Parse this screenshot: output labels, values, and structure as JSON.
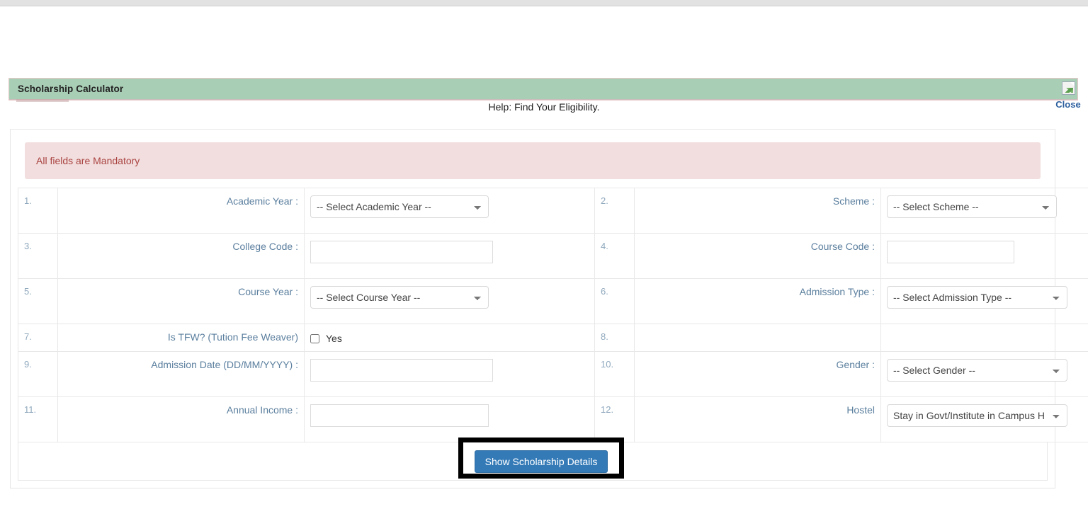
{
  "panel": {
    "title": "Scholarship Calculator",
    "close_icon": "broken-image-icon",
    "close_label": "Close"
  },
  "help_text": "Help: Find Your Eligibility.",
  "alert": {
    "message": "All fields are Mandatory"
  },
  "form": {
    "rows": [
      {
        "left": {
          "index": "1.",
          "label": "Academic Year :",
          "control": "select",
          "value": "-- Select Academic Year --"
        },
        "right": {
          "index": "2.",
          "label": "Scheme :",
          "control": "select",
          "value": "-- Select Scheme --"
        }
      },
      {
        "left": {
          "index": "3.",
          "label": "College Code :",
          "control": "text",
          "value": ""
        },
        "right": {
          "index": "4.",
          "label": "Course Code :",
          "control": "text",
          "value": ""
        }
      },
      {
        "left": {
          "index": "5.",
          "label": "Course Year :",
          "control": "select",
          "value": "-- Select Course Year --"
        },
        "right": {
          "index": "6.",
          "label": "Admission Type :",
          "control": "select",
          "value": "-- Select Admission Type --"
        }
      },
      {
        "left": {
          "index": "7.",
          "label": "Is TFW? (Tution Fee Weaver)",
          "control": "checkbox",
          "value": "Yes"
        },
        "right": {
          "index": "8.",
          "label": "",
          "control": "none",
          "value": ""
        }
      },
      {
        "left": {
          "index": "9.",
          "label": "Admission Date (DD/MM/YYYY) :",
          "control": "text",
          "value": ""
        },
        "right": {
          "index": "10.",
          "label": "Gender :",
          "control": "select",
          "value": "-- Select Gender --"
        }
      },
      {
        "left": {
          "index": "11.",
          "label": "Annual Income :",
          "control": "text",
          "value": ""
        },
        "right": {
          "index": "12.",
          "label": "Hostel",
          "control": "select",
          "value": "Stay in Govt/Institute in Campus H"
        }
      }
    ],
    "submit_label": "Show Scholarship Details"
  },
  "colors": {
    "panel_header": "#a9ceb6",
    "alert_bg": "#f2dede",
    "alert_text": "#a94442",
    "label_text": "#5b7f9e",
    "submit_bg": "#337ab7",
    "close_link": "#2b5f9e",
    "highlight_border": "#000000"
  }
}
